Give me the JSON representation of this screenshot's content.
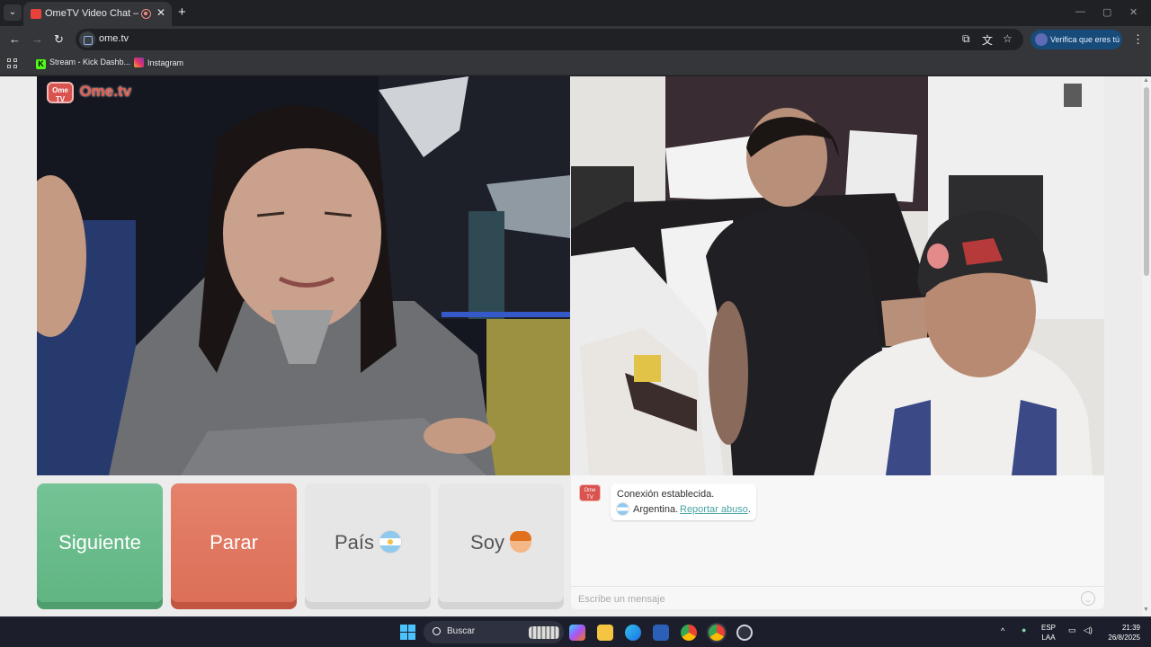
{
  "browser": {
    "tab_title": "OmeTV Video Chat — Omegle",
    "tab_close": "✕",
    "new_tab": "+",
    "url": "ome.tv",
    "verify_label": "Verifica que eres tú",
    "window_buttons": {
      "minimize": "—",
      "maximize": "▢",
      "close": "✕"
    }
  },
  "bookmarks": [
    {
      "label": "Stream - Kick Dashb...",
      "icon": "kick-icon",
      "color": "#53fc18"
    },
    {
      "label": "Instagram",
      "icon": "instagram-icon",
      "color": "#e1306c"
    }
  ],
  "site": {
    "logo_tv": "Ome\nTV",
    "logo_text": "Ome.tv",
    "buttons": {
      "next": "Siguiente",
      "stop": "Parar",
      "country": "País",
      "gender": "Soy"
    },
    "chat": {
      "status": "Conexión establecida.",
      "country": "Argentina.",
      "report_link": "Reportar abuso",
      "report_suffix": ".",
      "input_placeholder": "Escribe un mensaje"
    }
  },
  "taskbar": {
    "search_label": "Buscar",
    "language_top": "ESP",
    "language_bottom": "LAA",
    "time": "21:39",
    "date": "26/8/2025"
  },
  "colors": {
    "next_green": "#6cbf8d",
    "stop_red": "#e07a62",
    "link_teal": "#4aa3a3",
    "brand_red": "#d9534f"
  }
}
